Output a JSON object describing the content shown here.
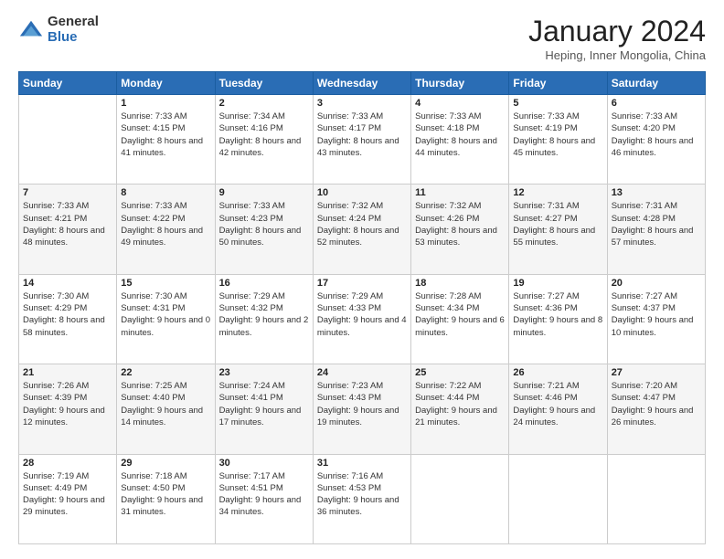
{
  "logo": {
    "general": "General",
    "blue": "Blue"
  },
  "header": {
    "month": "January 2024",
    "location": "Heping, Inner Mongolia, China"
  },
  "weekdays": [
    "Sunday",
    "Monday",
    "Tuesday",
    "Wednesday",
    "Thursday",
    "Friday",
    "Saturday"
  ],
  "weeks": [
    [
      {
        "day": "",
        "sunrise": "",
        "sunset": "",
        "daylight": ""
      },
      {
        "day": "1",
        "sunrise": "Sunrise: 7:33 AM",
        "sunset": "Sunset: 4:15 PM",
        "daylight": "Daylight: 8 hours and 41 minutes."
      },
      {
        "day": "2",
        "sunrise": "Sunrise: 7:34 AM",
        "sunset": "Sunset: 4:16 PM",
        "daylight": "Daylight: 8 hours and 42 minutes."
      },
      {
        "day": "3",
        "sunrise": "Sunrise: 7:33 AM",
        "sunset": "Sunset: 4:17 PM",
        "daylight": "Daylight: 8 hours and 43 minutes."
      },
      {
        "day": "4",
        "sunrise": "Sunrise: 7:33 AM",
        "sunset": "Sunset: 4:18 PM",
        "daylight": "Daylight: 8 hours and 44 minutes."
      },
      {
        "day": "5",
        "sunrise": "Sunrise: 7:33 AM",
        "sunset": "Sunset: 4:19 PM",
        "daylight": "Daylight: 8 hours and 45 minutes."
      },
      {
        "day": "6",
        "sunrise": "Sunrise: 7:33 AM",
        "sunset": "Sunset: 4:20 PM",
        "daylight": "Daylight: 8 hours and 46 minutes."
      }
    ],
    [
      {
        "day": "7",
        "sunrise": "Sunrise: 7:33 AM",
        "sunset": "Sunset: 4:21 PM",
        "daylight": "Daylight: 8 hours and 48 minutes."
      },
      {
        "day": "8",
        "sunrise": "Sunrise: 7:33 AM",
        "sunset": "Sunset: 4:22 PM",
        "daylight": "Daylight: 8 hours and 49 minutes."
      },
      {
        "day": "9",
        "sunrise": "Sunrise: 7:33 AM",
        "sunset": "Sunset: 4:23 PM",
        "daylight": "Daylight: 8 hours and 50 minutes."
      },
      {
        "day": "10",
        "sunrise": "Sunrise: 7:32 AM",
        "sunset": "Sunset: 4:24 PM",
        "daylight": "Daylight: 8 hours and 52 minutes."
      },
      {
        "day": "11",
        "sunrise": "Sunrise: 7:32 AM",
        "sunset": "Sunset: 4:26 PM",
        "daylight": "Daylight: 8 hours and 53 minutes."
      },
      {
        "day": "12",
        "sunrise": "Sunrise: 7:31 AM",
        "sunset": "Sunset: 4:27 PM",
        "daylight": "Daylight: 8 hours and 55 minutes."
      },
      {
        "day": "13",
        "sunrise": "Sunrise: 7:31 AM",
        "sunset": "Sunset: 4:28 PM",
        "daylight": "Daylight: 8 hours and 57 minutes."
      }
    ],
    [
      {
        "day": "14",
        "sunrise": "Sunrise: 7:30 AM",
        "sunset": "Sunset: 4:29 PM",
        "daylight": "Daylight: 8 hours and 58 minutes."
      },
      {
        "day": "15",
        "sunrise": "Sunrise: 7:30 AM",
        "sunset": "Sunset: 4:31 PM",
        "daylight": "Daylight: 9 hours and 0 minutes."
      },
      {
        "day": "16",
        "sunrise": "Sunrise: 7:29 AM",
        "sunset": "Sunset: 4:32 PM",
        "daylight": "Daylight: 9 hours and 2 minutes."
      },
      {
        "day": "17",
        "sunrise": "Sunrise: 7:29 AM",
        "sunset": "Sunset: 4:33 PM",
        "daylight": "Daylight: 9 hours and 4 minutes."
      },
      {
        "day": "18",
        "sunrise": "Sunrise: 7:28 AM",
        "sunset": "Sunset: 4:34 PM",
        "daylight": "Daylight: 9 hours and 6 minutes."
      },
      {
        "day": "19",
        "sunrise": "Sunrise: 7:27 AM",
        "sunset": "Sunset: 4:36 PM",
        "daylight": "Daylight: 9 hours and 8 minutes."
      },
      {
        "day": "20",
        "sunrise": "Sunrise: 7:27 AM",
        "sunset": "Sunset: 4:37 PM",
        "daylight": "Daylight: 9 hours and 10 minutes."
      }
    ],
    [
      {
        "day": "21",
        "sunrise": "Sunrise: 7:26 AM",
        "sunset": "Sunset: 4:39 PM",
        "daylight": "Daylight: 9 hours and 12 minutes."
      },
      {
        "day": "22",
        "sunrise": "Sunrise: 7:25 AM",
        "sunset": "Sunset: 4:40 PM",
        "daylight": "Daylight: 9 hours and 14 minutes."
      },
      {
        "day": "23",
        "sunrise": "Sunrise: 7:24 AM",
        "sunset": "Sunset: 4:41 PM",
        "daylight": "Daylight: 9 hours and 17 minutes."
      },
      {
        "day": "24",
        "sunrise": "Sunrise: 7:23 AM",
        "sunset": "Sunset: 4:43 PM",
        "daylight": "Daylight: 9 hours and 19 minutes."
      },
      {
        "day": "25",
        "sunrise": "Sunrise: 7:22 AM",
        "sunset": "Sunset: 4:44 PM",
        "daylight": "Daylight: 9 hours and 21 minutes."
      },
      {
        "day": "26",
        "sunrise": "Sunrise: 7:21 AM",
        "sunset": "Sunset: 4:46 PM",
        "daylight": "Daylight: 9 hours and 24 minutes."
      },
      {
        "day": "27",
        "sunrise": "Sunrise: 7:20 AM",
        "sunset": "Sunset: 4:47 PM",
        "daylight": "Daylight: 9 hours and 26 minutes."
      }
    ],
    [
      {
        "day": "28",
        "sunrise": "Sunrise: 7:19 AM",
        "sunset": "Sunset: 4:49 PM",
        "daylight": "Daylight: 9 hours and 29 minutes."
      },
      {
        "day": "29",
        "sunrise": "Sunrise: 7:18 AM",
        "sunset": "Sunset: 4:50 PM",
        "daylight": "Daylight: 9 hours and 31 minutes."
      },
      {
        "day": "30",
        "sunrise": "Sunrise: 7:17 AM",
        "sunset": "Sunset: 4:51 PM",
        "daylight": "Daylight: 9 hours and 34 minutes."
      },
      {
        "day": "31",
        "sunrise": "Sunrise: 7:16 AM",
        "sunset": "Sunset: 4:53 PM",
        "daylight": "Daylight: 9 hours and 36 minutes."
      },
      {
        "day": "",
        "sunrise": "",
        "sunset": "",
        "daylight": ""
      },
      {
        "day": "",
        "sunrise": "",
        "sunset": "",
        "daylight": ""
      },
      {
        "day": "",
        "sunrise": "",
        "sunset": "",
        "daylight": ""
      }
    ]
  ]
}
